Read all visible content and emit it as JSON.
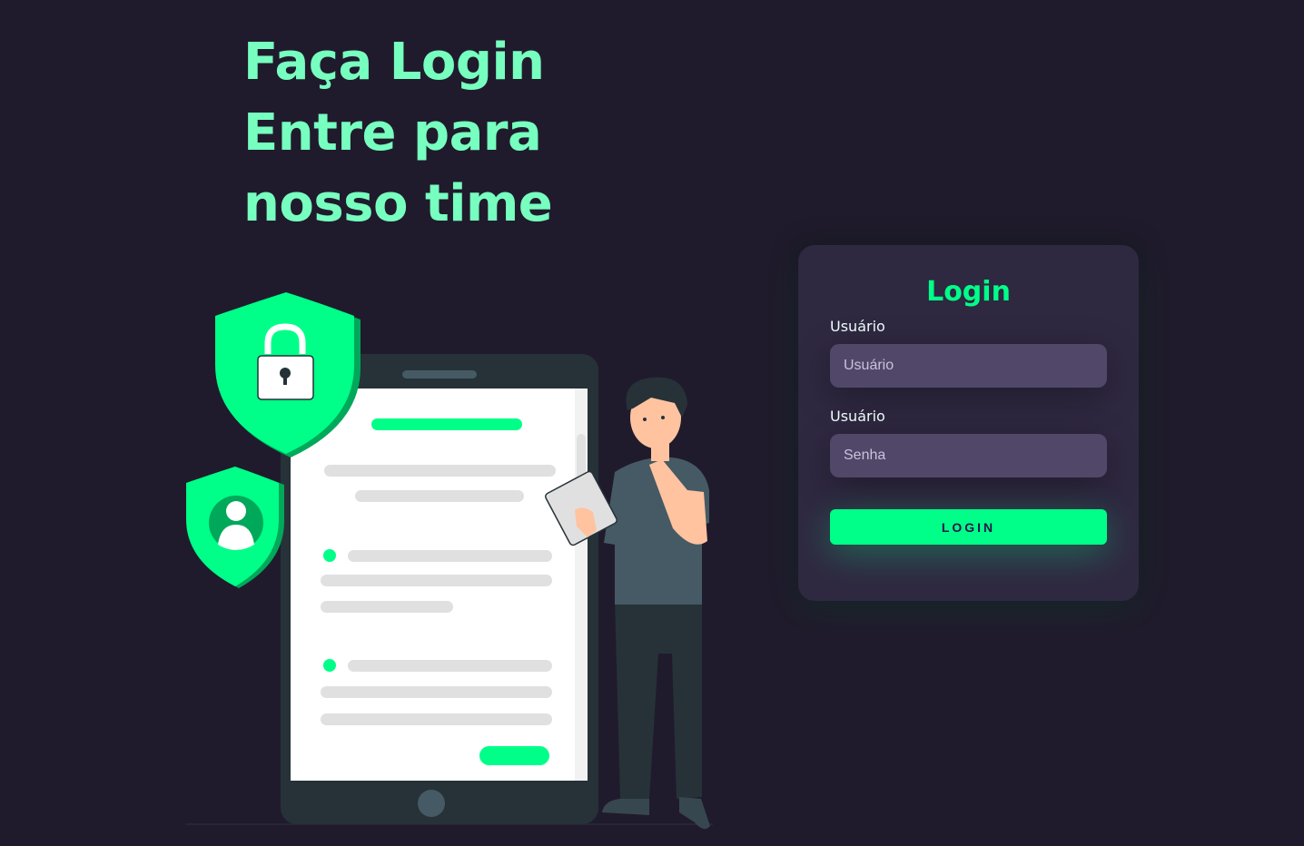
{
  "hero": {
    "line1": "Faça Login",
    "line2": "Entre para",
    "line3": "nosso time"
  },
  "illustration": {
    "icons": [
      "lock-shield-icon",
      "user-shield-icon",
      "smartphone",
      "person-with-tablet"
    ]
  },
  "login_card": {
    "title": "Login",
    "user_label": "Usuário",
    "user_placeholder": "Usuário",
    "password_label": "Usuário",
    "password_placeholder": "Senha",
    "button_label": "Login"
  },
  "colors": {
    "background": "#201b2c",
    "card": "#2f2841",
    "accent": "#00ff88",
    "headline": "#77ffc0",
    "input": "#514869"
  }
}
